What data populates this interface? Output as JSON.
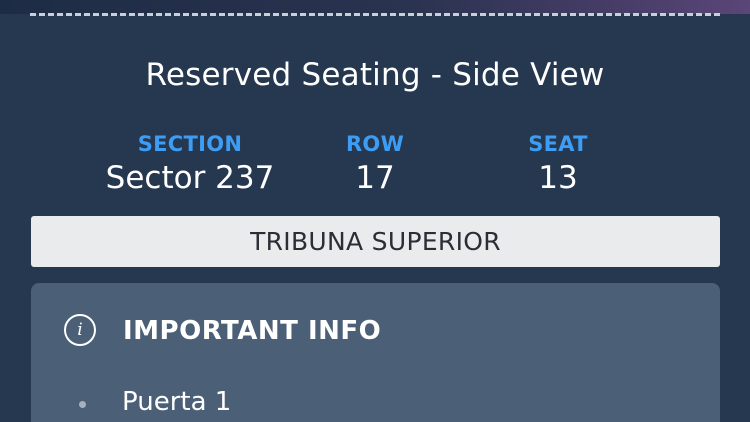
{
  "ticket": {
    "title": "Reserved Seating - Side View",
    "section_label": "SECTION",
    "section_value": "Sector 237",
    "row_label": "ROW",
    "row_value": "17",
    "seat_label": "SEAT",
    "seat_value": "13",
    "area": "TRIBUNA SUPERIOR"
  },
  "important_info": {
    "icon": "info-icon",
    "icon_glyph": "i",
    "heading": "IMPORTANT INFO",
    "items": [
      "Puerta 1"
    ]
  },
  "colors": {
    "background": "#26384f",
    "accent_label": "#3d9cf3",
    "area_bar": "#e9ebed",
    "info_card": "#4b5f77"
  }
}
